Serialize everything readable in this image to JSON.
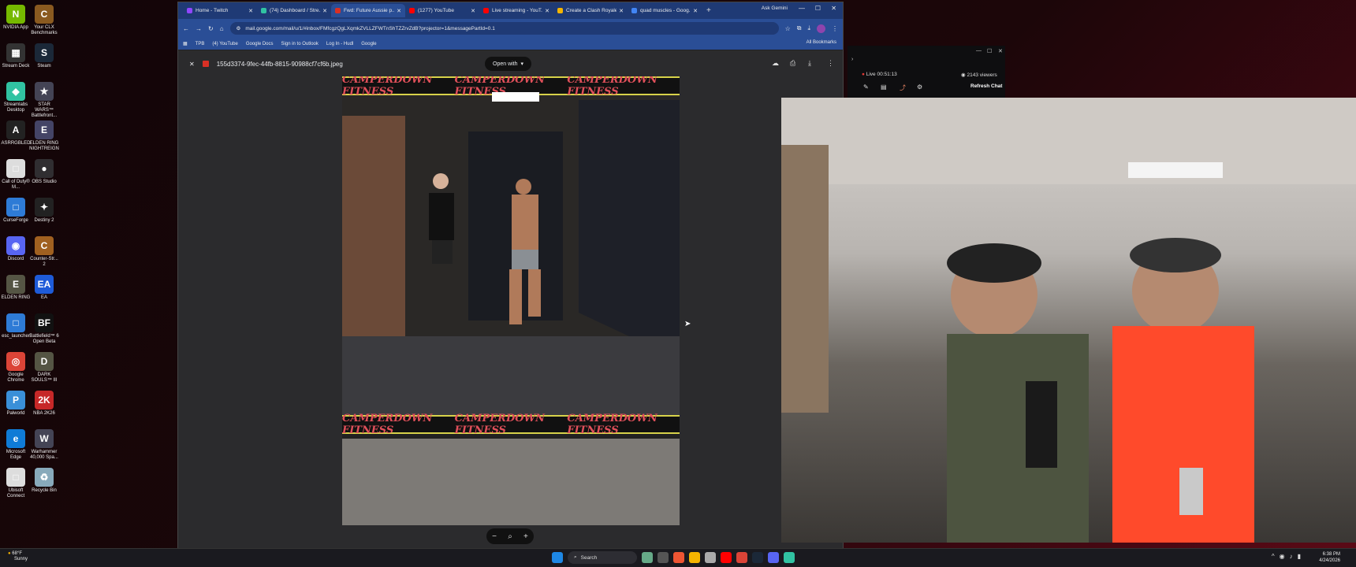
{
  "desktop": {
    "icons": [
      {
        "label": "NVIDIA App",
        "color": "#76b900",
        "glyph": "N"
      },
      {
        "label": "Your CLX Benchmarks",
        "color": "#8a5a20",
        "glyph": "C"
      },
      {
        "label": "Stream Deck",
        "color": "#333",
        "glyph": "▦"
      },
      {
        "label": "Steam",
        "color": "#1b2838",
        "glyph": "S"
      },
      {
        "label": "Streamlabs Desktop",
        "color": "#31c3a2",
        "glyph": "◆"
      },
      {
        "label": "STAR WARS™ Battlefront...",
        "color": "#445",
        "glyph": "★"
      },
      {
        "label": "ASRRGBLED",
        "color": "#222",
        "glyph": "A"
      },
      {
        "label": "ELDEN RING NIGHTREIGN",
        "color": "#446",
        "glyph": "E"
      },
      {
        "label": "Call of Duty® M...",
        "color": "#ddd",
        "glyph": "□"
      },
      {
        "label": "OBS Studio",
        "color": "#302e31",
        "glyph": "●"
      },
      {
        "label": "CurseForge",
        "color": "#2e7bd6",
        "glyph": "□"
      },
      {
        "label": "Destiny 2",
        "color": "#222",
        "glyph": "✦"
      },
      {
        "label": "Discord",
        "color": "#5865f2",
        "glyph": "◉"
      },
      {
        "label": "Counter-Str... 2",
        "color": "#a06020",
        "glyph": "C"
      },
      {
        "label": "ELDEN RING",
        "color": "#554",
        "glyph": "E"
      },
      {
        "label": "EA",
        "color": "#1e5bd8",
        "glyph": "EA"
      },
      {
        "label": "esc_launcher",
        "color": "#2e7bd6",
        "glyph": "□"
      },
      {
        "label": "Battlefield™ 6 Open Beta",
        "color": "#111",
        "glyph": "BF"
      },
      {
        "label": "Google Chrome",
        "color": "#db4437",
        "glyph": "◎"
      },
      {
        "label": "DARK SOULS™ III",
        "color": "#554",
        "glyph": "D"
      },
      {
        "label": "Palworld",
        "color": "#3a8fd8",
        "glyph": "P"
      },
      {
        "label": "NBA 2K26",
        "color": "#c62828",
        "glyph": "2K"
      },
      {
        "label": "Microsoft Edge",
        "color": "#0f7bd6",
        "glyph": "e"
      },
      {
        "label": "Warhammer 40,000 Spa...",
        "color": "#445",
        "glyph": "W"
      },
      {
        "label": "Ubisoft Connect",
        "color": "#ddd",
        "glyph": "□"
      },
      {
        "label": "Recycle Bin",
        "color": "#8ab",
        "glyph": "♻"
      }
    ]
  },
  "browser": {
    "tabs": [
      {
        "title": "Home - Twitch",
        "color": "#9146ff"
      },
      {
        "title": "(74) Dashboard / Stre...",
        "color": "#31c3a2"
      },
      {
        "title": "Fwd: Future Aussie p...",
        "color": "#d93025"
      },
      {
        "title": "(1277) YouTube",
        "color": "#ff0000"
      },
      {
        "title": "Live streaming - YouT...",
        "color": "#ff0000"
      },
      {
        "title": "Create a Clash Royale...",
        "color": "#f4b400"
      },
      {
        "title": "quad muscles - Goog...",
        "color": "#4285f4"
      }
    ],
    "active_tab_index": 2,
    "new_tab": "+",
    "ask_gemini": "Ask Gemini",
    "url": "mail.google.com/mail/u/1/#inbox/FMfcgzQgLXqmkZVLLZFWTnShTZZrvZdB?projector=1&messagePartId=0.1",
    "bookmarks": [
      "TPB",
      "(4) YouTube",
      "Google Docs",
      "Sign in to Outlook",
      "Log In - Hudl",
      "Google"
    ],
    "all_bookmarks": "All Bookmarks"
  },
  "viewer": {
    "filename": "155d3374-9fec-44fb-8815-90988cf7cf6b.jpeg",
    "open_with": "Open with",
    "banner_text": "CAMPERDOWN   FITNESS"
  },
  "stream_panel": {
    "live": "Live 00:51:13",
    "viewers": "2143 viewers",
    "refresh_chat": "Refresh Chat"
  },
  "taskbar": {
    "weather_temp": "68°F",
    "weather_cond": "Sunny",
    "search": "Search",
    "time": "6:38 PM",
    "date": "4/24/2026"
  }
}
